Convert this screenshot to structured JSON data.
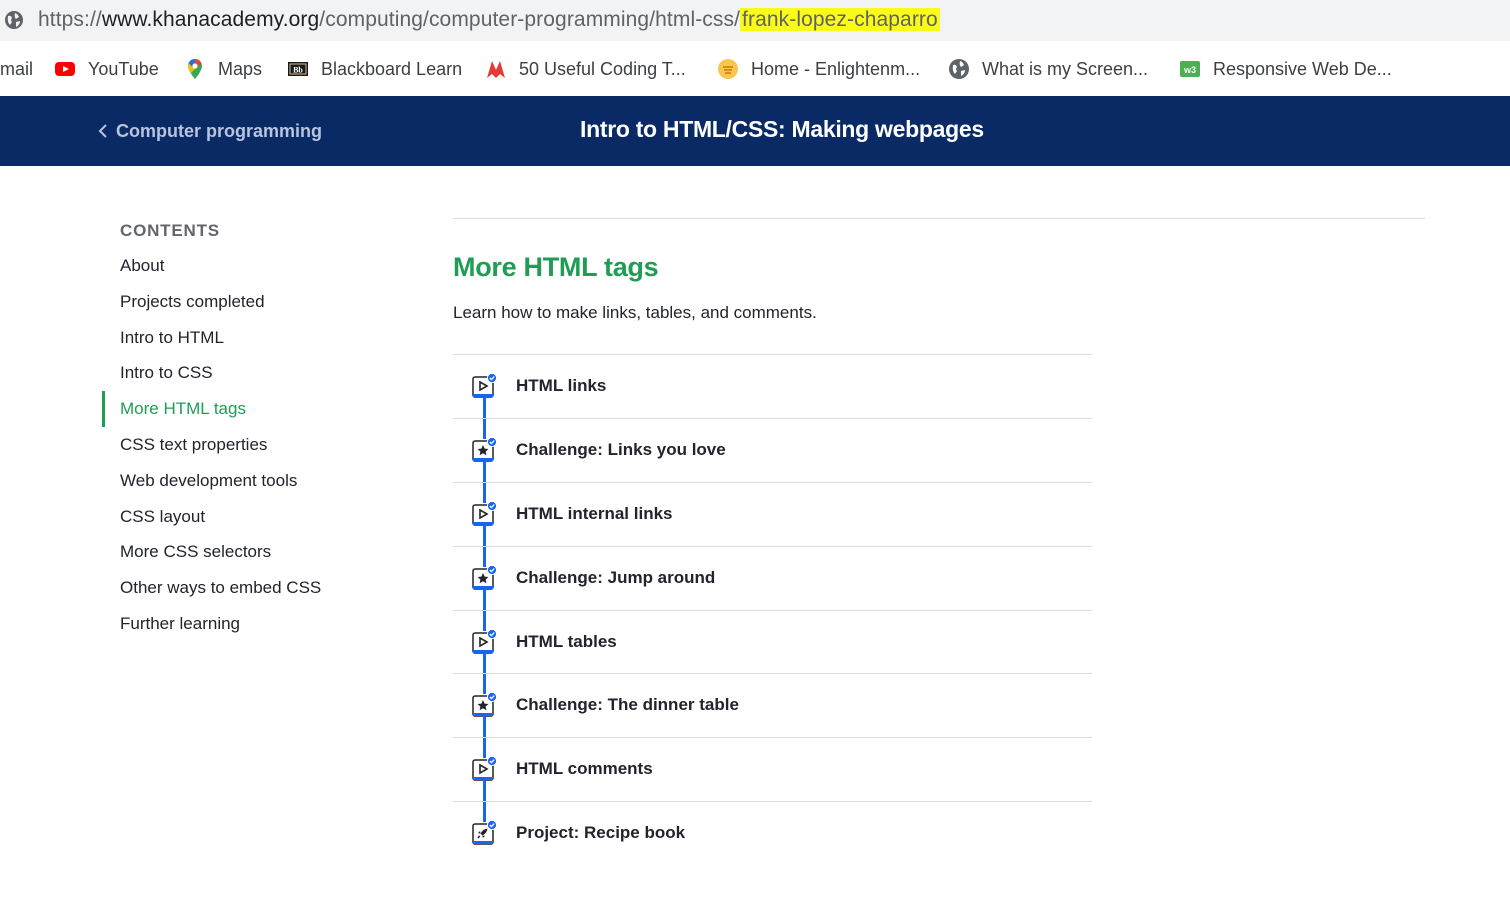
{
  "browser": {
    "url_prefix": "https://",
    "url_domain": "www.khanacademy.org",
    "url_path": "/computing/computer-programming/html-css/",
    "url_highlight": "frank-lopez-chaparro",
    "bookmarks": [
      {
        "label": "mail",
        "icon": "none"
      },
      {
        "label": "YouTube",
        "icon": "youtube-icon"
      },
      {
        "label": "Maps",
        "icon": "maps-pin-icon"
      },
      {
        "label": "Blackboard Learn",
        "icon": "blackboard-icon"
      },
      {
        "label": "50 Useful Coding T...",
        "icon": "coding-icon"
      },
      {
        "label": "Home - Enlightenm...",
        "icon": "enlightenment-icon"
      },
      {
        "label": "What is my Screen...",
        "icon": "globe-icon"
      },
      {
        "label": "Responsive Web De...",
        "icon": "w3-icon"
      }
    ]
  },
  "header": {
    "back_label": "Computer programming",
    "title": "Intro to HTML/CSS: Making webpages"
  },
  "sidebar": {
    "contents_label": "CONTENTS",
    "items": [
      {
        "label": "About",
        "active": false
      },
      {
        "label": "Projects completed",
        "active": false
      },
      {
        "label": "Intro to HTML",
        "active": false
      },
      {
        "label": "Intro to CSS",
        "active": false
      },
      {
        "label": "More HTML tags",
        "active": true
      },
      {
        "label": "CSS text properties",
        "active": false
      },
      {
        "label": "Web development tools",
        "active": false
      },
      {
        "label": "CSS layout",
        "active": false
      },
      {
        "label": "More CSS selectors",
        "active": false
      },
      {
        "label": "Other ways to embed CSS",
        "active": false
      },
      {
        "label": "Further learning",
        "active": false
      }
    ]
  },
  "section": {
    "title": "More HTML tags",
    "description": "Learn how to make links, tables, and comments."
  },
  "lessons": [
    {
      "label": "HTML links",
      "kind": "talkthrough",
      "icon": "play-icon",
      "completed": true
    },
    {
      "label": "Challenge: Links you love",
      "kind": "challenge",
      "icon": "star-icon",
      "completed": true
    },
    {
      "label": "HTML internal links",
      "kind": "talkthrough",
      "icon": "play-icon",
      "completed": true
    },
    {
      "label": "Challenge: Jump around",
      "kind": "challenge",
      "icon": "star-icon",
      "completed": true
    },
    {
      "label": "HTML tables",
      "kind": "talkthrough",
      "icon": "play-icon",
      "completed": true
    },
    {
      "label": "Challenge: The dinner table",
      "kind": "challenge",
      "icon": "star-icon",
      "completed": true
    },
    {
      "label": "HTML comments",
      "kind": "talkthrough",
      "icon": "play-icon",
      "completed": true
    },
    {
      "label": "Project: Recipe book",
      "kind": "project",
      "icon": "rocket-icon",
      "completed": true
    }
  ],
  "colors": {
    "header_bg": "#0a2a66",
    "accent_green": "#1f9d55",
    "progress_blue": "#1865f2",
    "url_highlight": "#fbfb1a"
  }
}
